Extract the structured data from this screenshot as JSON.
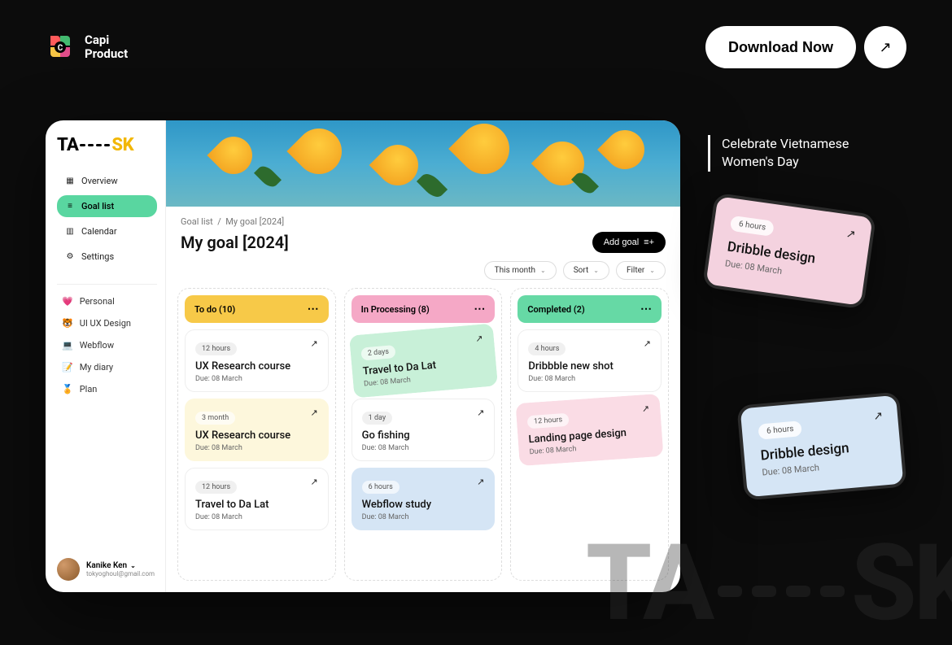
{
  "brand": {
    "name_line1": "Capi",
    "name_line2": "Product"
  },
  "top": {
    "download": "Download Now"
  },
  "tagline": {
    "line1": "Celebrate Vietnamese",
    "line2": "Women's Day"
  },
  "app": {
    "logo": {
      "part1": "TA",
      "part2": "SK"
    },
    "nav": [
      {
        "label": "Overview",
        "active": false
      },
      {
        "label": "Goal list",
        "active": true
      },
      {
        "label": "Calendar",
        "active": false
      },
      {
        "label": "Settings",
        "active": false
      }
    ],
    "tags": [
      {
        "emoji": "💗",
        "label": "Personal"
      },
      {
        "emoji": "🐯",
        "label": "UI UX Design"
      },
      {
        "emoji": "💻",
        "label": "Webflow"
      },
      {
        "emoji": "📝",
        "label": "My diary"
      },
      {
        "emoji": "🏅",
        "label": "Plan"
      }
    ],
    "user": {
      "name": "Kanike Ken",
      "email": "tokyoghoul@gmail.com"
    },
    "breadcrumb": {
      "root": "Goal list",
      "current": "My goal [2024]"
    },
    "page_title": "My goal [2024]",
    "add_goal": "Add goal",
    "filters": {
      "period": "This month",
      "sort": "Sort",
      "filter": "Filter"
    },
    "columns": {
      "todo": {
        "title": "To do (10)",
        "cards": [
          {
            "chip": "12 hours",
            "title": "UX Research course",
            "due": "Due: 08 March",
            "style": "plain"
          },
          {
            "chip": "3 month",
            "title": "UX Research course",
            "due": "Due: 08 March",
            "style": "pale-yellow"
          },
          {
            "chip": "12 hours",
            "title": "Travel to Da Lat",
            "due": "Due: 08 March",
            "style": "plain"
          }
        ]
      },
      "inprog": {
        "title": "In Processing (8)",
        "cards": [
          {
            "chip": "2 days",
            "title": "Travel to Da Lat",
            "due": "Due: 08 March",
            "style": "mint",
            "rot": 1
          },
          {
            "chip": "1 day",
            "title": "Go fishing",
            "due": "Due: 08 March",
            "style": "plain"
          },
          {
            "chip": "6 hours",
            "title": "Webflow study",
            "due": "Due: 08 March",
            "style": "blue"
          }
        ]
      },
      "done": {
        "title": "Completed (2)",
        "cards": [
          {
            "chip": "4 hours",
            "title": "Dribbble new shot",
            "due": "Due: 08 March",
            "style": "plain"
          },
          {
            "chip": "12 hours",
            "title": "Landing page design",
            "due": "Due: 08 March",
            "style": "pink",
            "rot": 2
          }
        ]
      }
    }
  },
  "float": [
    {
      "chip": "6 hours",
      "title": "Dribble design",
      "due": "Due: 08 March"
    },
    {
      "chip": "6 hours",
      "title": "Dribble design",
      "due": "Due: 08 March"
    }
  ]
}
